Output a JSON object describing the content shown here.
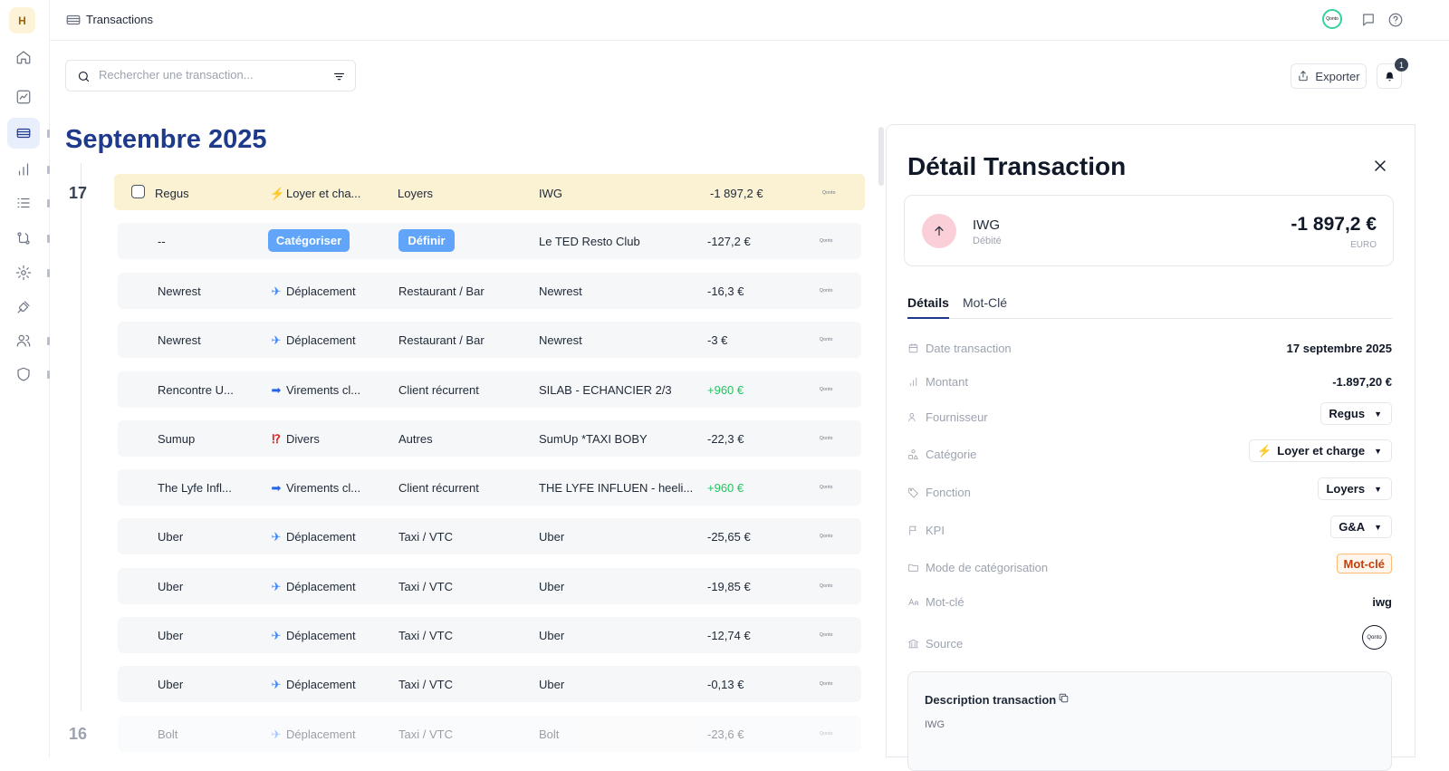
{
  "user": {
    "initial": "H"
  },
  "header": {
    "title": "Transactions"
  },
  "search": {
    "placeholder": "Rechercher une transaction..."
  },
  "actions": {
    "export_label": "Exporter",
    "notifications_count": "1"
  },
  "month": {
    "title": "Septembre 2025"
  },
  "days": [
    {
      "label": "17"
    },
    {
      "label": "16"
    }
  ],
  "transactions": [
    {
      "name": "Regus",
      "category_emoji": "⚡",
      "category": "Loyer et cha...",
      "function": "Loyers",
      "counterparty": "IWG",
      "amount": "-1 897,2 €",
      "source": "Qonto"
    },
    {
      "name": "--",
      "category_btn": "Catégoriser",
      "function_btn": "Définir",
      "counterparty": "Le TED Resto Club",
      "amount": "-127,2 €",
      "source": "Qonto"
    },
    {
      "name": "Newrest",
      "category_emoji": "✈",
      "category": "Déplacement",
      "function": "Restaurant / Bar",
      "counterparty": "Newrest",
      "amount": "-16,3 €",
      "source": "Qonto"
    },
    {
      "name": "Newrest",
      "category_emoji": "✈",
      "category": "Déplacement",
      "function": "Restaurant / Bar",
      "counterparty": "Newrest",
      "amount": "-3 €",
      "source": "Qonto"
    },
    {
      "name": "Rencontre U...",
      "category_emoji": "➡",
      "category": "Virements cl...",
      "function": "Client récurrent",
      "counterparty": "SILAB - ECHANCIER 2/3",
      "amount": "+960 €",
      "source": "Qonto"
    },
    {
      "name": "Sumup",
      "category_emoji": "⁉",
      "category": "Divers",
      "function": "Autres",
      "counterparty": "SumUp *TAXI BOBY",
      "amount": "-22,3 €",
      "source": "Qonto"
    },
    {
      "name": "The Lyfe Infl...",
      "category_emoji": "➡",
      "category": "Virements cl...",
      "function": "Client récurrent",
      "counterparty": "THE LYFE INFLUEN - heeli...",
      "amount": "+960 €",
      "source": "Qonto"
    },
    {
      "name": "Uber",
      "category_emoji": "✈",
      "category": "Déplacement",
      "function": "Taxi / VTC",
      "counterparty": "Uber",
      "amount": "-25,65 €",
      "source": "Qonto"
    },
    {
      "name": "Uber",
      "category_emoji": "✈",
      "category": "Déplacement",
      "function": "Taxi / VTC",
      "counterparty": "Uber",
      "amount": "-19,85 €",
      "source": "Qonto"
    },
    {
      "name": "Uber",
      "category_emoji": "✈",
      "category": "Déplacement",
      "function": "Taxi / VTC",
      "counterparty": "Uber",
      "amount": "-12,74 €",
      "source": "Qonto"
    },
    {
      "name": "Uber",
      "category_emoji": "✈",
      "category": "Déplacement",
      "function": "Taxi / VTC",
      "counterparty": "Uber",
      "amount": "-0,13 €",
      "source": "Qonto"
    },
    {
      "name": "Bolt",
      "category_emoji": "✈",
      "category": "Déplacement",
      "function": "Taxi / VTC",
      "counterparty": "Bolt",
      "amount": "-23,6 €",
      "source": "Qonto"
    }
  ],
  "detail": {
    "title": "Détail Transaction",
    "summary": {
      "name": "IWG",
      "status": "Débité",
      "amount": "-1 897,2 €",
      "currency": "EURO"
    },
    "tabs": [
      "Détails",
      "Mot-Clé"
    ],
    "fields": {
      "date": {
        "label": "Date transaction",
        "value": "17 septembre 2025"
      },
      "amount": {
        "label": "Montant",
        "value": "-1.897,20 €"
      },
      "supplier": {
        "label": "Fournisseur",
        "value": "Regus"
      },
      "category": {
        "label": "Catégorie",
        "emoji": "⚡",
        "value": "Loyer et charge"
      },
      "function": {
        "label": "Fonction",
        "value": "Loyers"
      },
      "kpi": {
        "label": "KPI",
        "value": "G&A"
      },
      "mode": {
        "label": "Mode de catégorisation",
        "value": "Mot-clé"
      },
      "keyword": {
        "label": "Mot-clé",
        "value": "iwg"
      },
      "source": {
        "label": "Source",
        "value": "Qonto"
      }
    },
    "description": {
      "title": "Description transaction",
      "text": "IWG"
    }
  },
  "colors": {
    "accent": "#1e3a8a",
    "selected_row": "#fbf1d3",
    "pill": "#60a5fa",
    "positive": "#22c55e",
    "mode_tag": "#c2410c"
  }
}
